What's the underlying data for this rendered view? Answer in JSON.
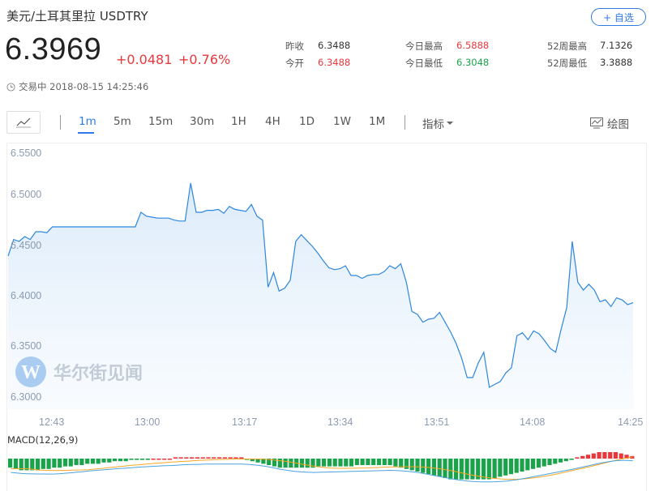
{
  "header": {
    "title": "美元/土耳其里拉 USDTRY",
    "follow_label": "+ 自选",
    "price": "6.3969",
    "change": "+0.0481",
    "change_pct": "+0.76%",
    "status": "交易中 2018-08-15 14:25:46"
  },
  "stats": [
    {
      "label": "昨收",
      "value": "6.3488",
      "color": "#333333"
    },
    {
      "label": "今开",
      "value": "6.3488",
      "color": "#e8383d"
    },
    {
      "label": "今日最高",
      "value": "6.5888",
      "color": "#e8383d"
    },
    {
      "label": "今日最低",
      "value": "6.3048",
      "color": "#1aa34a"
    },
    {
      "label": "52周最高",
      "value": "7.1326",
      "color": "#333333"
    },
    {
      "label": "52周最低",
      "value": "3.3888",
      "color": "#333333"
    }
  ],
  "toolbar": {
    "periods": [
      "1m",
      "5m",
      "15m",
      "30m",
      "1H",
      "4H",
      "1D",
      "1W",
      "1M"
    ],
    "active_period": "1m",
    "indicator_label": "指标",
    "draw_label": "绘图"
  },
  "watermark": "华尔街见闻",
  "colors": {
    "line": "#2e86de",
    "area": "#eaf3fc",
    "up": "#e8383d",
    "down": "#1aa34a",
    "dif": "#4aa3df",
    "dea": "#f5a623"
  },
  "chart_data": {
    "type": "line",
    "ylim": [
      6.28,
      6.56
    ],
    "y_ticks": [
      "6.5500",
      "6.5000",
      "6.4500",
      "6.4000",
      "6.3500",
      "6.3000"
    ],
    "x_ticks": [
      "12:43",
      "13:00",
      "13:17",
      "13:34",
      "13:51",
      "14:08",
      "14:25"
    ],
    "series": [
      {
        "values": [
          6.445,
          6.462,
          6.46,
          6.465,
          6.462,
          6.47,
          6.47,
          6.469,
          6.475,
          6.475,
          6.475,
          6.475,
          6.475,
          6.475,
          6.475,
          6.475,
          6.475,
          6.475,
          6.475,
          6.475,
          6.475,
          6.475,
          6.475,
          6.475,
          6.49,
          6.486,
          6.485,
          6.484,
          6.484,
          6.484,
          6.482,
          6.481,
          6.481,
          6.52,
          6.49,
          6.49,
          6.492,
          6.492,
          6.493,
          6.489,
          6.496,
          6.493,
          6.492,
          6.491,
          6.498,
          6.486,
          6.482,
          6.413,
          6.428,
          6.409,
          6.412,
          6.42,
          6.46,
          6.467,
          6.461,
          6.455,
          6.448,
          6.44,
          6.433,
          6.431,
          6.432,
          6.435,
          6.425,
          6.425,
          6.422,
          6.425,
          6.426,
          6.426,
          6.429,
          6.435,
          6.432,
          6.437,
          6.418,
          6.388,
          6.385,
          6.377,
          6.38,
          6.381,
          6.387,
          6.377,
          6.367,
          6.355,
          6.34,
          6.32,
          6.32,
          6.335,
          6.346,
          6.31,
          6.313,
          6.316,
          6.325,
          6.33,
          6.363,
          6.366,
          6.359,
          6.368,
          6.365,
          6.358,
          6.35,
          6.346,
          6.37,
          6.392,
          6.46,
          6.418,
          6.41,
          6.416,
          6.41,
          6.398,
          6.4,
          6.393,
          6.402,
          6.4,
          6.395,
          6.397
        ]
      }
    ],
    "macd": {
      "label": "MACD(12,26,9)",
      "histogram": [
        -7,
        -8,
        -9,
        -9,
        -9,
        -9,
        -8,
        -8,
        -7,
        -7,
        -6,
        -6,
        -5,
        -5,
        -4,
        -4,
        -4,
        -3,
        -3,
        -2,
        -2,
        -2,
        -1,
        -1,
        -1,
        -1,
        0,
        0,
        0,
        0,
        1,
        1,
        1,
        1,
        1,
        1,
        1,
        1,
        1,
        1,
        1,
        1,
        1,
        -1,
        -2,
        -3,
        -4,
        -5,
        -6,
        -7,
        -7,
        -7,
        -7,
        -7,
        -7,
        -7,
        -6,
        -6,
        -6,
        -6,
        -6,
        -6,
        -6,
        -5,
        -5,
        -5,
        -5,
        -5,
        -5,
        -5,
        -6,
        -7,
        -8,
        -9,
        -10,
        -11,
        -12,
        -13,
        -14,
        -15,
        -16,
        -16,
        -16,
        -16,
        -16,
        -16,
        -16,
        -16,
        -15,
        -14,
        -13,
        -12,
        -11,
        -10,
        -9,
        -8,
        -7,
        -6,
        -5,
        -4,
        -3,
        -2,
        -1,
        1,
        2,
        3,
        4,
        5,
        5,
        5,
        5,
        4,
        3,
        2
      ]
    }
  }
}
